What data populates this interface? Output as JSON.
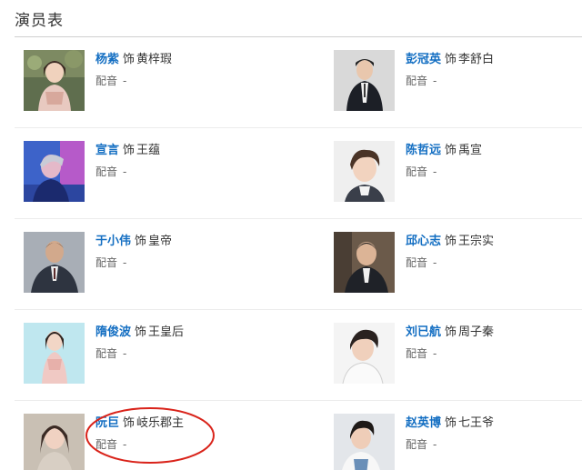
{
  "section": {
    "title": "演员表"
  },
  "cast": [
    [
      {
        "actor": "杨紫",
        "as": "饰",
        "role": "黄梓瑕",
        "dub_label": "配音",
        "dub_value": "-"
      },
      {
        "actor": "彭冠英",
        "as": "饰",
        "role": "李舒白",
        "dub_label": "配音",
        "dub_value": "-"
      }
    ],
    [
      {
        "actor": "宣言",
        "as": "饰",
        "role": "王蕴",
        "dub_label": "配音",
        "dub_value": "-"
      },
      {
        "actor": "陈哲远",
        "as": "饰",
        "role": "禹宣",
        "dub_label": "配音",
        "dub_value": "-"
      }
    ],
    [
      {
        "actor": "于小伟",
        "as": "饰",
        "role": "皇帝",
        "dub_label": "配音",
        "dub_value": "-"
      },
      {
        "actor": "邱心志",
        "as": "饰",
        "role": "王宗实",
        "dub_label": "配音",
        "dub_value": "-"
      }
    ],
    [
      {
        "actor": "隋俊波",
        "as": "饰",
        "role": "王皇后",
        "dub_label": "配音",
        "dub_value": "-"
      },
      {
        "actor": "刘已航",
        "as": "饰",
        "role": "周子秦",
        "dub_label": "配音",
        "dub_value": "-"
      }
    ],
    [
      {
        "actor": "阮巨",
        "as": "饰",
        "role": "岐乐郡主",
        "dub_label": "配音",
        "dub_value": "-"
      },
      {
        "actor": "赵英博",
        "as": "饰",
        "role": "七王爷",
        "dub_label": "配音",
        "dub_value": "-"
      }
    ]
  ],
  "colors": {
    "link": "#136ec2",
    "annotation": "#d9231a"
  },
  "photos": [
    [
      "portrait-photo-garden",
      "portrait-photo-dark-suit"
    ],
    [
      "portrait-photo-blue-light",
      "portrait-photo-studio"
    ],
    [
      "portrait-photo-grey-suit",
      "portrait-photo-dark-suit"
    ],
    [
      "portrait-photo-pale-dress",
      "portrait-photo-white-shirt"
    ],
    [
      "portrait-photo-soft",
      "portrait-photo-casual"
    ]
  ]
}
